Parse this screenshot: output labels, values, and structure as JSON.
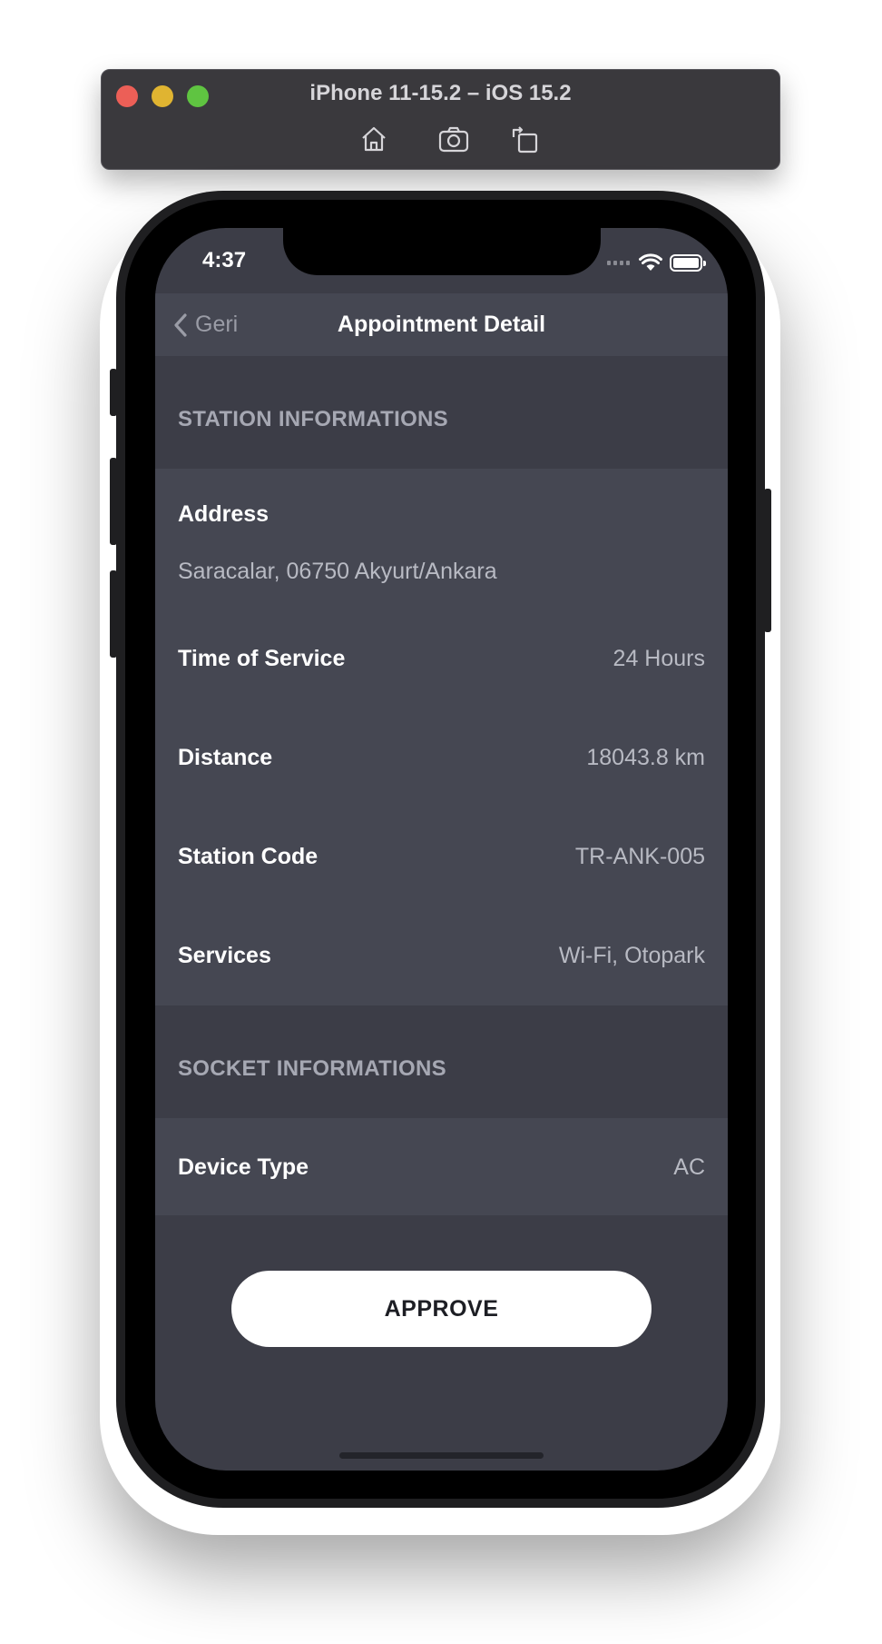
{
  "simulator": {
    "title": "iPhone 11-15.2 – iOS 15.2",
    "toolbar": [
      {
        "icon": "home-icon"
      },
      {
        "icon": "camera-icon"
      },
      {
        "icon": "rotate-icon"
      }
    ]
  },
  "status_bar": {
    "time": "4:37"
  },
  "nav": {
    "back_label": "Geri",
    "title": "Appointment Detail"
  },
  "station_section": {
    "header": "STATION INFORMATIONS",
    "address_label": "Address",
    "address_value": "Saracalar, 06750 Akyurt/Ankara",
    "rows": [
      {
        "label": "Time of Service",
        "value": "24 Hours"
      },
      {
        "label": "Distance",
        "value": "18043.8 km"
      },
      {
        "label": "Station Code",
        "value": "TR-ANK-005"
      },
      {
        "label": "Services",
        "value": "Wi-Fi, Otopark"
      }
    ]
  },
  "socket_section": {
    "header": "SOCKET INFORMATIONS",
    "rows": [
      {
        "label": "Device Type",
        "value": "AC"
      }
    ]
  },
  "actions": {
    "approve_label": "APPROVE"
  },
  "colors": {
    "screen_bg": "#3c3d47",
    "group_bg": "#454752",
    "section_header_text": "#a6a8b3",
    "value_text": "#b8bac3",
    "approve_bg": "#ffffff"
  }
}
